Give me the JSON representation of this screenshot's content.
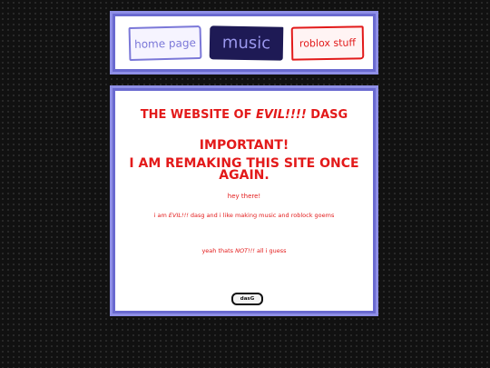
{
  "nav": {
    "home_label": "home page",
    "music_label": "music",
    "roblox_label": "roblox stuff"
  },
  "content": {
    "title_prefix": "THE WEBSITE OF ",
    "title_evil": "EVIL!!!!",
    "title_suffix": " DASG",
    "important": "IMPORTANT!",
    "remaking": "I AM REMAKING THIS SITE ONCE AGAIN.",
    "greeting": "hey there!",
    "intro_prefix": "i am ",
    "intro_evil": "EVIL!!!",
    "intro_suffix": " dasg and i like making music and roblock goems",
    "closing_prefix": "yeah thats ",
    "closing_not": "NOT!!!",
    "closing_suffix": " all i guess",
    "signature": "dasG"
  },
  "colors": {
    "accent_red": "#e31a1a",
    "border_purple": "#8f8fe6",
    "music_bg": "#1e1a55"
  }
}
